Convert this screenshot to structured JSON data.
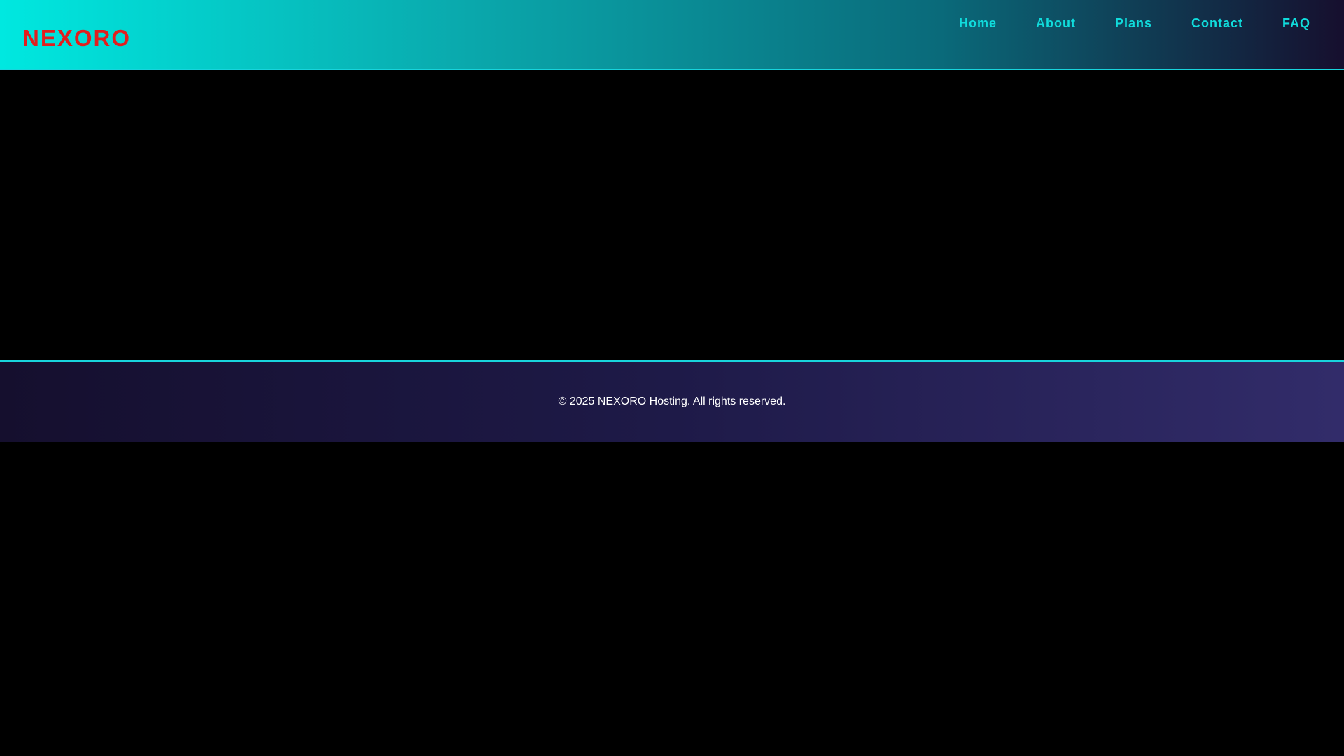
{
  "header": {
    "logo": "NEXORO",
    "nav": [
      {
        "label": "Home"
      },
      {
        "label": "About"
      },
      {
        "label": "Plans"
      },
      {
        "label": "Contact"
      },
      {
        "label": "FAQ"
      }
    ]
  },
  "footer": {
    "copyright": "© 2025 NEXORO Hosting. All rights reserved."
  },
  "colors": {
    "logo": "#e21e1e",
    "nav_link": "#10dcdc",
    "accent_border": "#18d4dc",
    "background": "#000000"
  }
}
